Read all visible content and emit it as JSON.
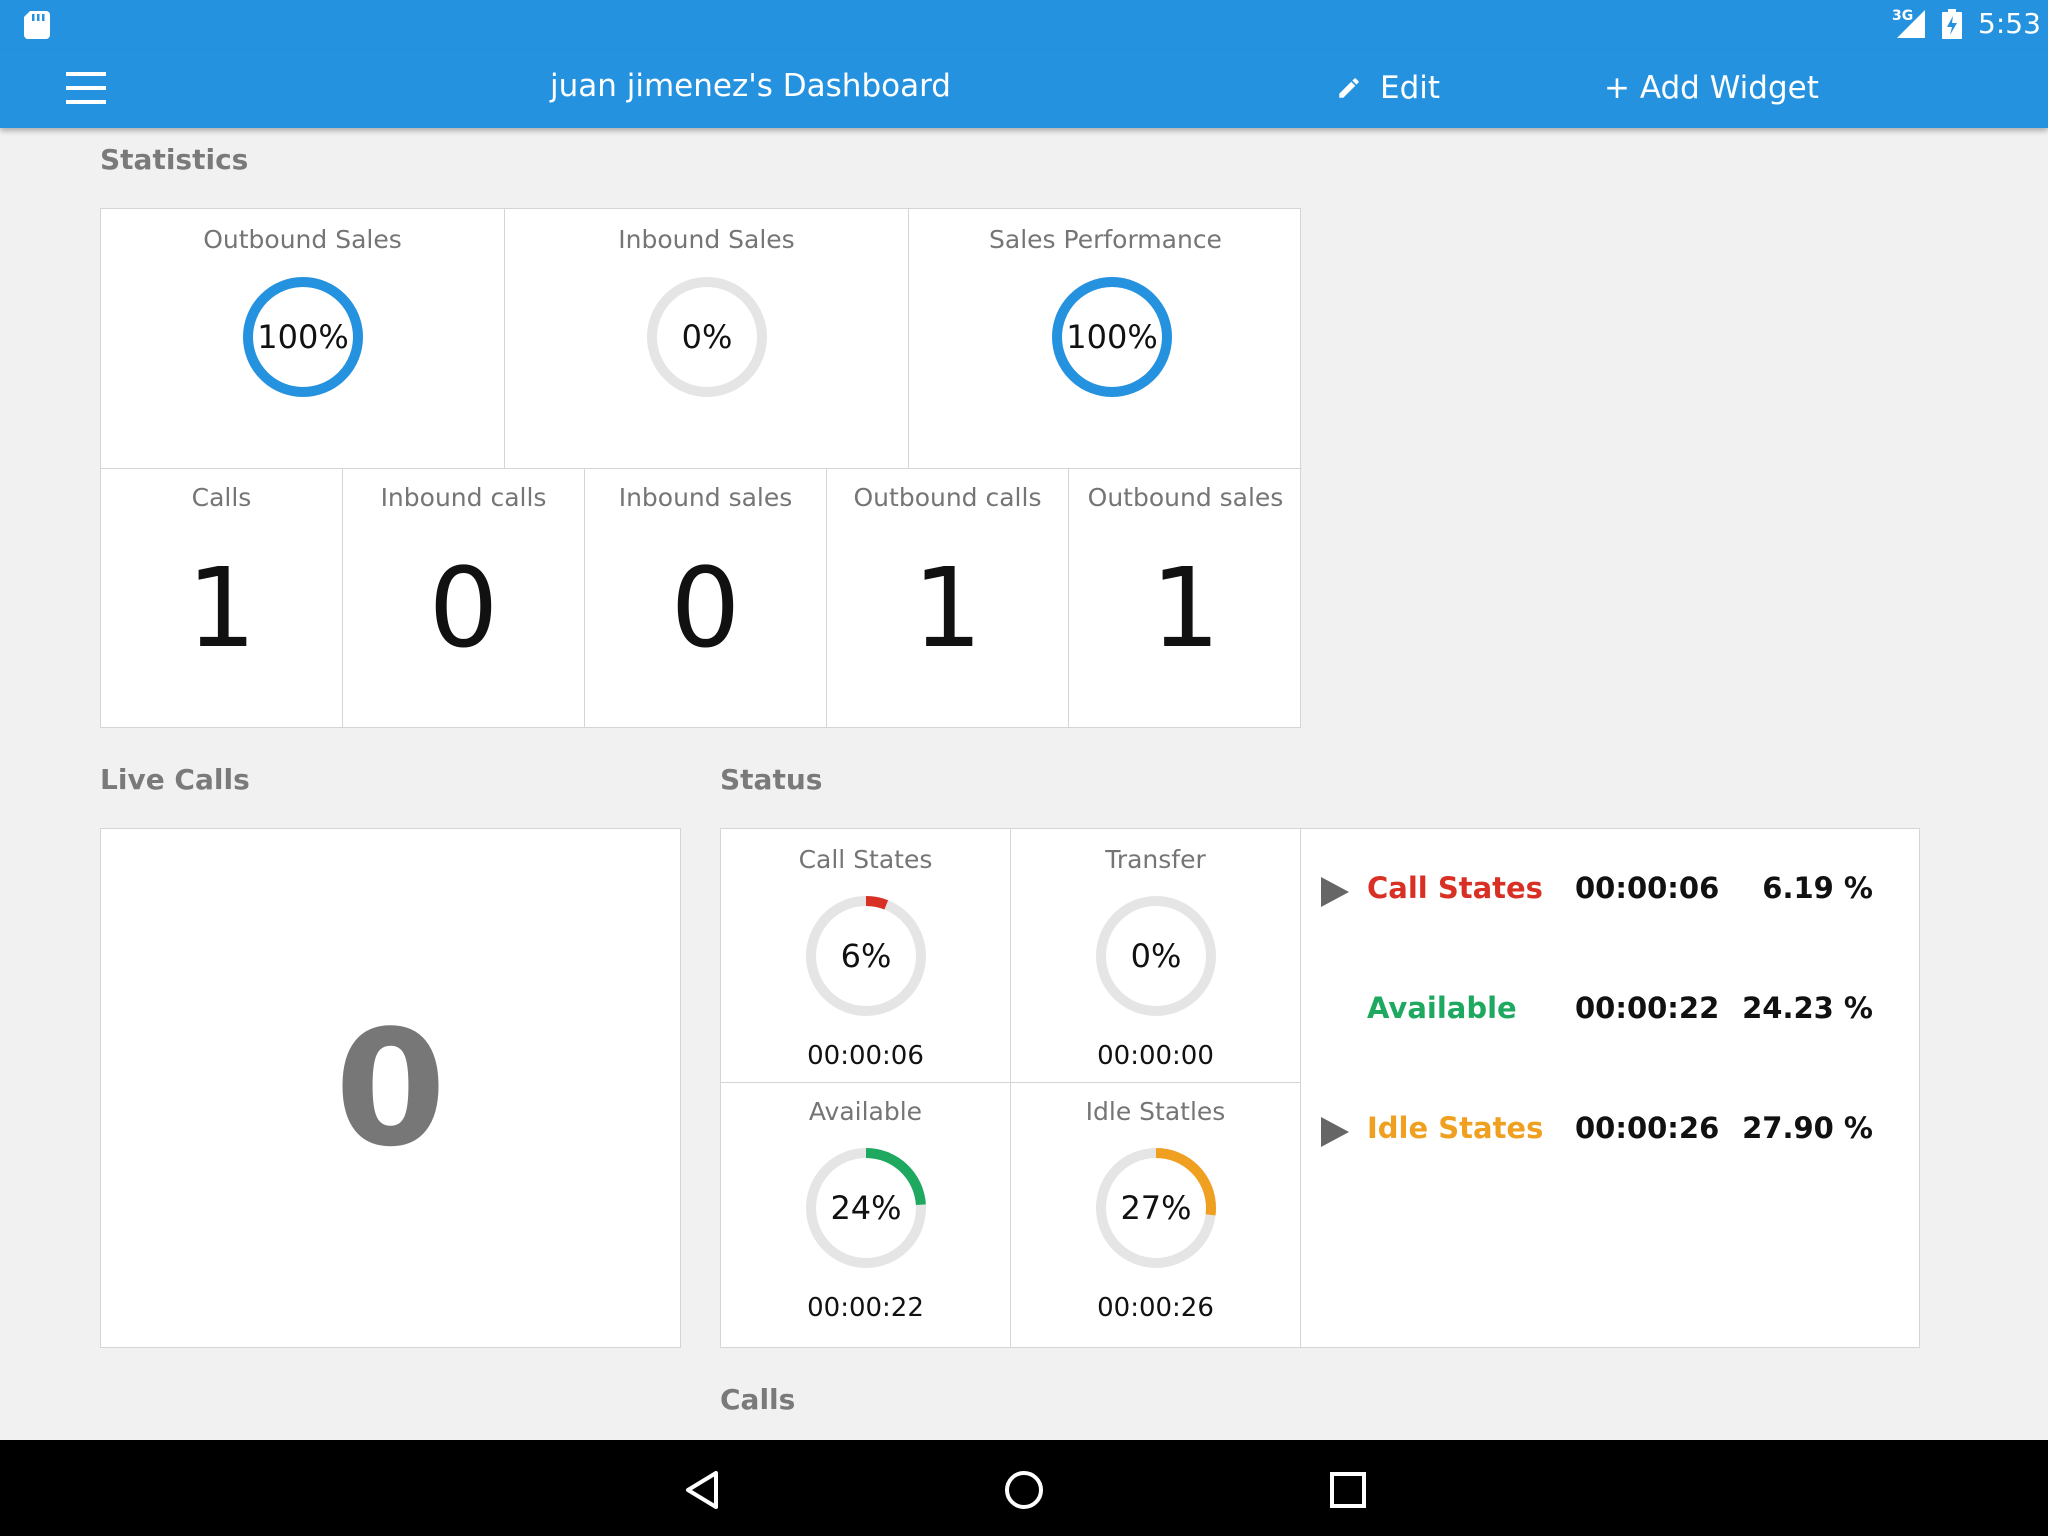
{
  "status_bar": {
    "network": "3G",
    "time": "5:53"
  },
  "app_bar": {
    "title": "juan jimenez's Dashboard",
    "edit_label": "Edit",
    "add_widget_label": "+ Add Widget"
  },
  "statistics": {
    "section_title": "Statistics",
    "gauges": [
      {
        "label": "Outbound Sales",
        "percent_text": "100%",
        "value": 100
      },
      {
        "label": "Inbound Sales",
        "percent_text": "0%",
        "value": 0
      },
      {
        "label": "Sales Performance",
        "percent_text": "100%",
        "value": 100
      }
    ],
    "counters": [
      {
        "label": "Calls",
        "value": "1"
      },
      {
        "label": "Inbound calls",
        "value": "0"
      },
      {
        "label": "Inbound sales",
        "value": "0"
      },
      {
        "label": "Outbound calls",
        "value": "1"
      },
      {
        "label": "Outbound sales",
        "value": "1"
      }
    ]
  },
  "live_calls": {
    "section_title": "Live Calls",
    "value": "0"
  },
  "status": {
    "section_title": "Status",
    "gauges": [
      {
        "label": "Call States",
        "percent_text": "6%",
        "value": 6,
        "time": "00:00:06",
        "color": "#d93025"
      },
      {
        "label": "Transfer",
        "percent_text": "0%",
        "value": 0,
        "time": "00:00:00",
        "color": "#d93025"
      },
      {
        "label": "Available",
        "percent_text": "24%",
        "value": 24,
        "time": "00:00:22",
        "color": "#1ea860"
      },
      {
        "label": "Idle Statles",
        "percent_text": "27%",
        "value": 27,
        "time": "00:00:26",
        "color": "#f0a020"
      }
    ],
    "legend": [
      {
        "name": "Call States",
        "time": "00:00:06",
        "percent": "6.19 %",
        "color": "#d93025",
        "expandable": true
      },
      {
        "name": "Available",
        "time": "00:00:22",
        "percent": "24.23 %",
        "color": "#1ea860",
        "expandable": false
      },
      {
        "name": "Idle States",
        "time": "00:00:26",
        "percent": "27.90 %",
        "color": "#f0a020",
        "expandable": true
      }
    ]
  },
  "calls": {
    "section_title": "Calls"
  },
  "colors": {
    "primary": "#2592e0",
    "ring_track": "#e5e5e5",
    "ring_fill": "#2592e0"
  }
}
